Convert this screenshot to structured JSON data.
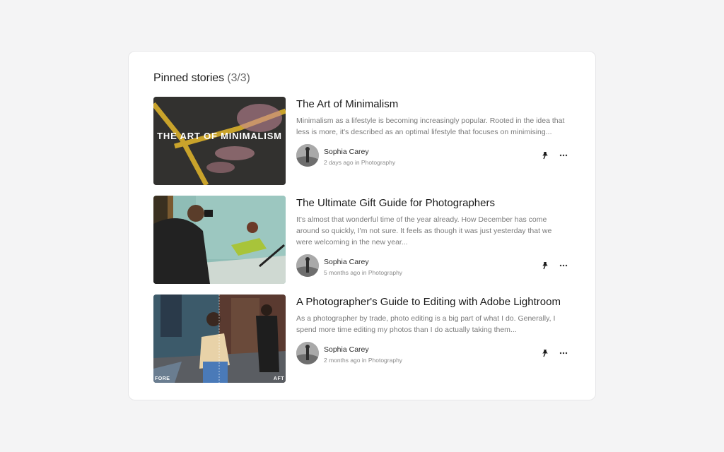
{
  "section": {
    "title": "Pinned stories",
    "count": "(3/3)"
  },
  "stories": [
    {
      "title": "The Art of Minimalism",
      "excerpt": "Minimalism as a lifestyle is becoming increasingly popular. Rooted in the idea that less is more, it's described as an optimal lifestyle that focuses on minimising...",
      "thumbnail_text": "THE ART OF MINIMALISM",
      "author": "Sophia Carey",
      "meta": "2 days ago in Photography",
      "pin_icon": "pin-icon",
      "more_icon": "more-horizontal-icon"
    },
    {
      "title": "The Ultimate Gift Guide for Photographers",
      "excerpt": "It's almost that wonderful time of the year already. How December has come around so quickly, I'm not sure. It feels as though it was just yesterday that we were welcoming in the new year...",
      "author": "Sophia Carey",
      "meta": "5 months ago in Photography",
      "pin_icon": "pin-icon",
      "more_icon": "more-horizontal-icon"
    },
    {
      "title": "A Photographer's Guide to Editing with Adobe Lightroom",
      "excerpt": "As a photographer by trade, photo editing is a big part of what I do. Generally, I spend more time editing my photos than I do actually taking them...",
      "thumbnail_left_label": "FORE",
      "thumbnail_right_label": "AFT",
      "author": "Sophia Carey",
      "meta": "2 months ago in Photography",
      "pin_icon": "pin-icon",
      "more_icon": "more-horizontal-icon"
    }
  ],
  "colors": {
    "page_bg": "#f4f4f5",
    "card_bg": "#ffffff",
    "title_text": "#1a1a1a",
    "excerpt_text": "#7a7a7a",
    "meta_text": "#8a8a8a"
  }
}
